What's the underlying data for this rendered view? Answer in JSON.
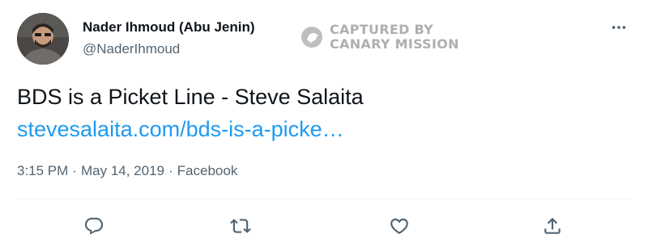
{
  "author": {
    "display_name": "Nader Ihmoud (Abu Jenin)",
    "handle": "@NaderIhmoud"
  },
  "watermark": {
    "line1": "CAPTURED BY",
    "line2": "CANARY MISSION"
  },
  "tweet": {
    "text": "BDS is a Picket Line - Steve Salaita",
    "link": "stevesalaita.com/bds-is-a-picke…"
  },
  "meta": {
    "time": "3:15 PM",
    "separator": "·",
    "date": "May 14, 2019",
    "source": "Facebook"
  },
  "icons": {
    "more": "more-horizontal-icon",
    "reply": "reply-icon",
    "retweet": "retweet-icon",
    "like": "like-heart-icon",
    "share": "share-icon"
  },
  "colors": {
    "text_primary": "#0f1419",
    "text_secondary": "#536471",
    "link": "#1d9bf0",
    "divider": "#eff3f4"
  }
}
